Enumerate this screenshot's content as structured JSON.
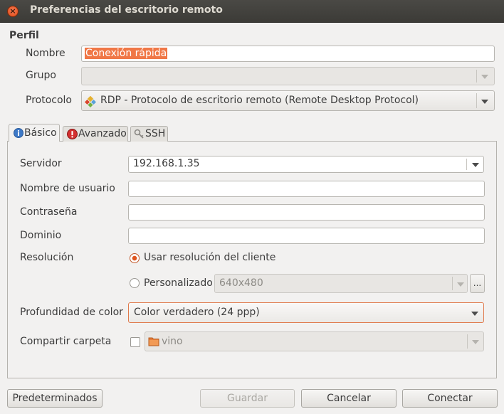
{
  "window": {
    "title": "Preferencias del escritorio remoto"
  },
  "profile": {
    "section_label": "Perfil",
    "name_label": "Nombre",
    "name_value": "Conexión rápida",
    "group_label": "Grupo",
    "group_value": "",
    "protocol_label": "Protocolo",
    "protocol_value": "RDP - Protocolo de escritorio remoto (Remote Desktop Protocol)"
  },
  "tabs": [
    {
      "label": "Básico",
      "icon": "info-icon",
      "active": true
    },
    {
      "label": "Avanzado",
      "icon": "warning-icon",
      "active": false
    },
    {
      "label": "SSH",
      "icon": "key-icon",
      "active": false
    }
  ],
  "basic": {
    "server_label": "Servidor",
    "server_value": "192.168.1.35",
    "username_label": "Nombre de usuario",
    "username_value": "",
    "password_label": "Contraseña",
    "password_value": "",
    "domain_label": "Dominio",
    "domain_value": "",
    "resolution_label": "Resolución",
    "resolution_client_label": "Usar resolución del cliente",
    "resolution_custom_label": "Personalizado",
    "resolution_custom_value": "640x480",
    "resolution_more_label": "...",
    "color_depth_label": "Profundidad de color",
    "color_depth_value": "Color verdadero (24 ppp)",
    "share_folder_label": "Compartir carpeta",
    "share_folder_value": "vino"
  },
  "buttons": {
    "defaults": "Predeterminados",
    "save": "Guardar",
    "cancel": "Cancelar",
    "connect": "Conectar"
  },
  "colors": {
    "accent": "#e0551e",
    "titlebar": "#3c3b37",
    "selection": "#f07746"
  }
}
